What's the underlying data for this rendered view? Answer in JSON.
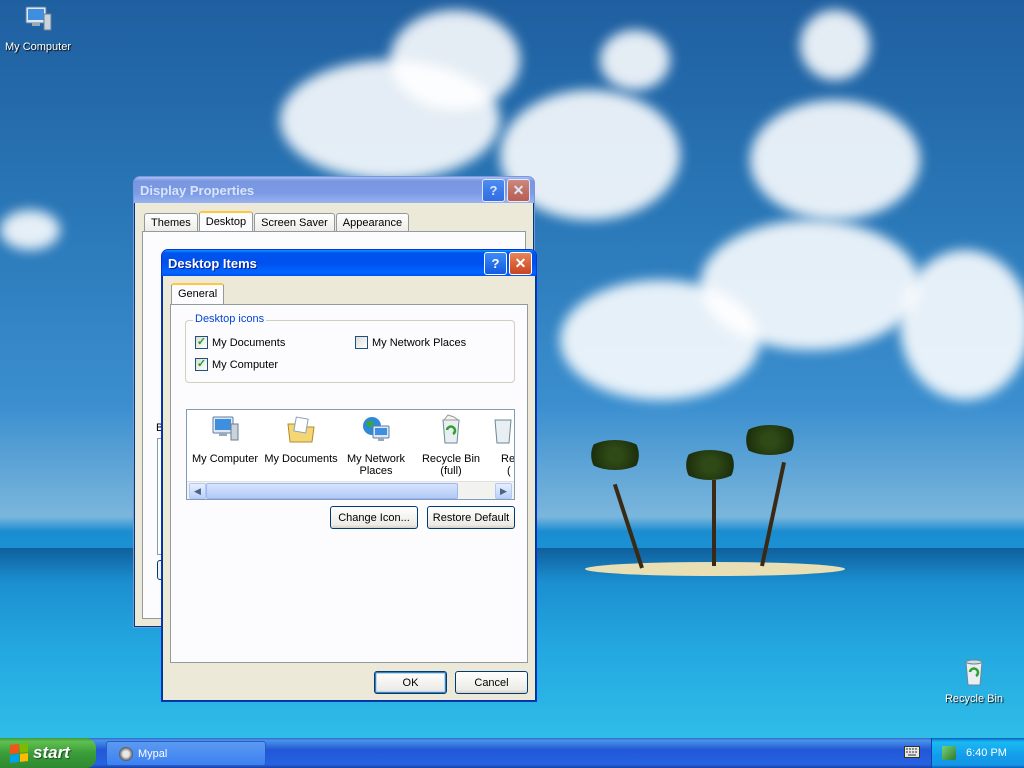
{
  "desktop": {
    "icons": [
      {
        "label": "My Computer",
        "icon": "my-computer-icon"
      },
      {
        "label": "Recycle Bin",
        "icon": "recycle-bin-icon"
      }
    ]
  },
  "display_properties": {
    "title": "Display Properties",
    "help_button": "?",
    "close_button": "✕",
    "tabs": [
      "Themes",
      "Desktop",
      "Screen Saver",
      "Appearance"
    ],
    "active_tab": "Desktop",
    "partial_label": "B"
  },
  "desktop_items": {
    "title": "Desktop Items",
    "help_button": "?",
    "close_button": "✕",
    "tab": "General",
    "groupbox_label": "Desktop icons",
    "checkboxes": [
      {
        "label": "My Documents",
        "checked": true
      },
      {
        "label": "My Network Places",
        "checked": false
      },
      {
        "label": "My Computer",
        "checked": true
      }
    ],
    "icon_list": [
      {
        "line1": "My Computer",
        "line2": "",
        "icon": "my-computer-icon"
      },
      {
        "line1": "My Documents",
        "line2": "",
        "icon": "my-documents-icon"
      },
      {
        "line1": "My Network",
        "line2": "Places",
        "icon": "network-places-icon"
      },
      {
        "line1": "Recycle Bin",
        "line2": "(full)",
        "icon": "recycle-bin-full-icon"
      },
      {
        "line1": "Re",
        "line2": "(",
        "icon": "recycle-bin-empty-icon"
      }
    ],
    "change_icon_button": "Change Icon...",
    "restore_default_button": "Restore Default",
    "ok_button": "OK",
    "cancel_button": "Cancel"
  },
  "taskbar": {
    "start_label": "start",
    "task": "Mypal",
    "clock": "6:40 PM"
  },
  "colors": {
    "xp_blue": "#0053ee",
    "start_green": "#3a9d3a",
    "dialog_face": "#ece9d8"
  }
}
